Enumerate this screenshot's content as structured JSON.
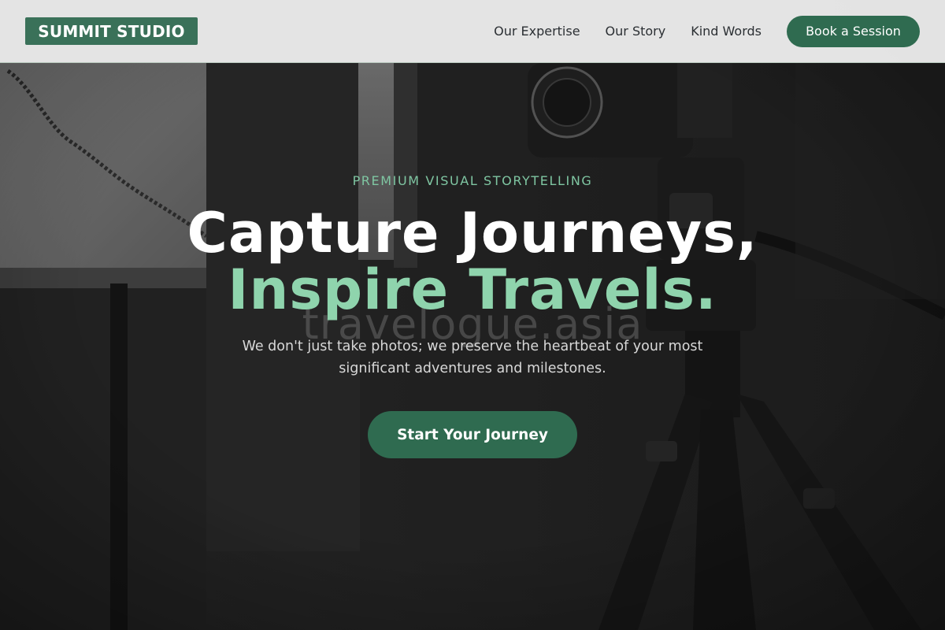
{
  "colors": {
    "brand_green": "#3a7159",
    "button_green": "#2f6b50",
    "accent_mint": "#8fd4ad",
    "eyebrow_mint": "#7fc6a2",
    "nav_bg": "#ececec"
  },
  "navbar": {
    "logo": "SUMMIT STUDIO",
    "links": [
      "Our Expertise",
      "Our Story",
      "Kind Words"
    ],
    "cta": "Book a Session"
  },
  "hero": {
    "eyebrow": "PREMIUM VISUAL STORYTELLING",
    "headline_line1": "Capture Journeys,",
    "headline_line2": "Inspire Travels.",
    "watermark": "travelogue.asia",
    "subtext": "We don't just take photos; we preserve the heartbeat of your most significant adventures and milestones.",
    "cta": "Start Your Journey",
    "background_image": "camera-on-tripod-photo"
  }
}
